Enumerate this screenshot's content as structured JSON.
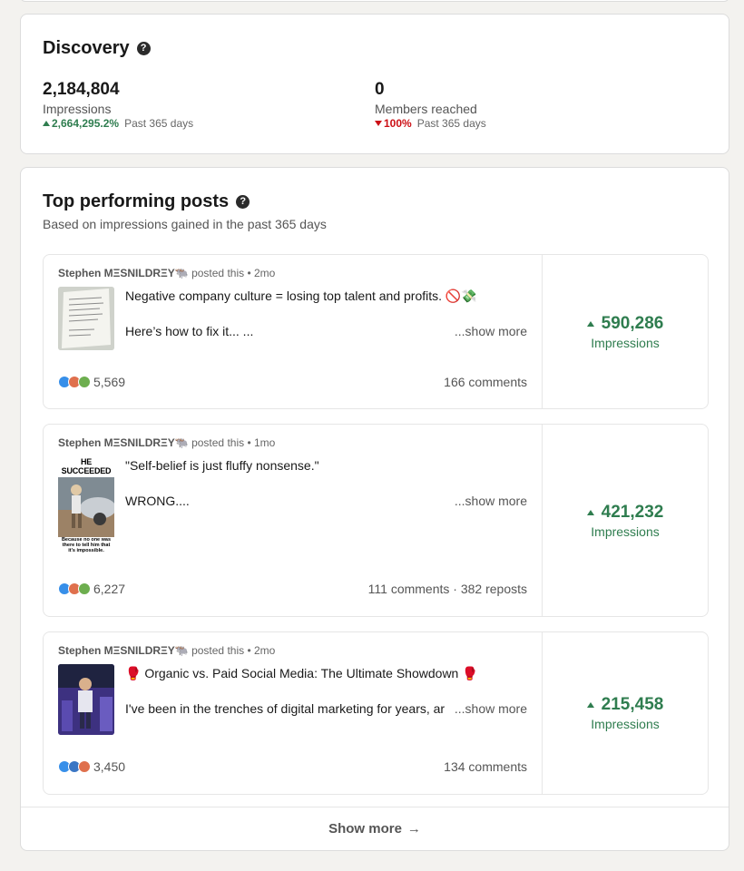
{
  "discovery": {
    "title": "Discovery",
    "impressions": {
      "value": "2,184,804",
      "label": "Impressions",
      "delta": "2,664,295.2%",
      "period": "Past 365 days"
    },
    "members": {
      "value": "0",
      "label": "Members reached",
      "delta": "100%",
      "period": "Past 365 days"
    }
  },
  "top_posts": {
    "title": "Top performing posts",
    "subtitle": "Based on impressions gained in the past 365 days",
    "posted_this": "posted this",
    "show_more_link": "...show more",
    "impressions_label": "Impressions",
    "posts": [
      {
        "author": "Stephen MΞSNILDRΞY🐃",
        "age": "• 2mo",
        "line1": "Negative company culture = losing top talent and profits. 🚫💸",
        "line2": "Here’s how to fix it... ...",
        "reactions": "5,569",
        "comments": "166 comments",
        "impressions": "590,286"
      },
      {
        "author": "Stephen MΞSNILDRΞY🐃",
        "age": "• 1mo",
        "line1": "\"Self-belief is just fluffy nonsense.\"",
        "line2": "WRONG....",
        "reactions": "6,227",
        "comments": "111 comments · 382 reposts",
        "impressions": "421,232",
        "thumb_title": "HE SUCCEEDED",
        "thumb_caption": "Because no one was there to tell him that it's impossible."
      },
      {
        "author": "Stephen MΞSNILDRΞY🐃",
        "age": "• 2mo",
        "line1": "🥊 Organic vs. Paid Social Media: The Ultimate Showdown 🥊",
        "line2": "I've been in the trenches of digital marketing for years, ar",
        "reactions": "3,450",
        "comments": "134 comments",
        "impressions": "215,458"
      }
    ],
    "show_more": "Show more",
    "show_more_arrow": "→"
  },
  "colors": {
    "positive": "#2f7d4f",
    "negative": "#cc1016",
    "background": "#f3f2ef"
  }
}
